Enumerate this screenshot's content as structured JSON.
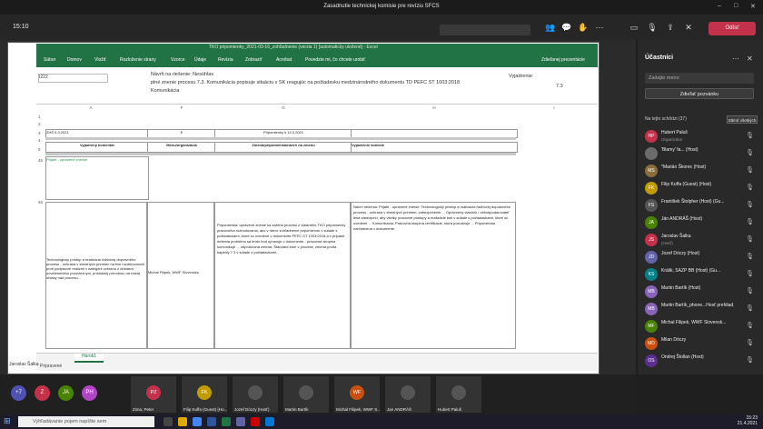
{
  "window": {
    "title": "Zasadnutie technickej komisie pre revíziu SFCS",
    "min": "–",
    "max": "□",
    "close": "✕"
  },
  "meeting": {
    "timer": "15:10",
    "toolbar_button_1": "Prestať prezentovať",
    "toolbar_button_2": "Zastaviť prezentáciu",
    "leave_label": "Odísť",
    "icons": [
      "participants-icon",
      "chat-icon",
      "raise-hand-icon",
      "more-icon",
      "camera-icon",
      "mic-icon",
      "share-icon"
    ]
  },
  "excel": {
    "title": "TKO pripomienky_2021-03-16_zohľadnenie (verzia 1) [automaticky uložené] - Excel",
    "ribbon_tabs": [
      "Súbor",
      "Domov",
      "Vložiť",
      "Rozloženie strany",
      "Vzorce",
      "Údaje",
      "Revízia",
      "Zobraziť",
      "Acrobat"
    ],
    "tell_me": "Povedzte mi, čo chcete urobiť",
    "share": "Zdieľanej prezentácie",
    "namebox": "I222",
    "formula_line1": "Návrh na riešenie: Nesúhlas",
    "formula_line2": "plné znenie procesu 7.3. Komunikácia popisuje situáciu v SK reagujúc na požiadavku medzinárodného dokumentu TD PEFC ST 1003:2018",
    "formula_line3": "Komunikácia",
    "formula_right": "Vyjadrenie:",
    "formula_right2": "7.3",
    "col_headers": [
      "A",
      "F",
      "G",
      "H",
      "I"
    ],
    "cells": {
      "date_label": "ZHŠ 5.3.2021",
      "col_g_header": "E",
      "col_h_header": "Pripomienky k 14.3.2021",
      "header_typ": "Vyjadrený komentár",
      "header_org": "Menu/organizácia",
      "header_zmena": "Zmena/pripomienka/návrh na zmenu",
      "header_vyj": "Vyjadrenie komisie",
      "row_a_text": "Prijaté - upravené zneniie",
      "left_comment": "Technologický prístup a realizácia ťažbovej dopravného procesu - ochrana v stredných premien na fixe rozdelovaních proti podpisové realizmi v kategórii ochranu z obstarov poveleneného proovieznym, príslušnéj prírodnou na nasta ohlasy nad procesu...",
      "org_cell": "Michal Filipek, WWF Slovensko",
      "middle_comment": "Pripomienka: upravené znenie sa zahŕňa procesu z vlastného TKO pripomienky pracovníka rozhodovania, ako v rámci zohľadnenie pripomienok v súlade s požiadavkami, ktoré sú uvedené v dokumente PEFC ST 1003:2018 a v prípade riešenia problému sa tento bod upravuje v dokumente - pracovná skupina komunikuje ... odporúčaná zmena: Štandard ktorí v procese, zmena podľa kapitoly 7.3 v súlade s požiadavkami...",
      "right_comment": "Návrh riešenia: Prijaté - upravené znenie: Technologický prístup a realizácia ťažbovej dopravného procesu - ochrana v stredných premien, zabezpečenie ... Oprávnený vlastník / obhospodarovateľ lesa zabezpečí, aby všetky pracovné postupy a realizácie boli v súlade s požiadavkami, ktoré sú uvedené ... Komunikácia. Pracovná skupina certifikácie, ktorá posudzuje ... Pripomienka zohľadnená v dokumente."
    },
    "row_numbers": [
      "1",
      "2",
      "3",
      "4",
      "5",
      "45",
      "46"
    ],
    "sheet_tab": "Hárok1",
    "status_left": "Pripravené",
    "presenter_label": "Jaroslav Šalka"
  },
  "panel": {
    "title": "Účastníci",
    "search_placeholder": "Zadajte meno",
    "share_btn": "Zdieľať pozvánku",
    "section_label": "Na tejto schôdzi (37)",
    "mute_all": "Stlmiť všetkých",
    "participants": [
      {
        "initials": "HP",
        "name": "Hubert Paluš",
        "sub": "Organizátor",
        "color": "#c4314b"
      },
      {
        "initials": "",
        "name": "'Blamy' fa... (Host)",
        "sub": "",
        "color": "#6b6b6b"
      },
      {
        "initials": "MS",
        "name": "*Marián Škorec (Host)",
        "sub": "",
        "color": "#8a6d3b"
      },
      {
        "initials": "FK",
        "name": "Filip Kuffa (Guest) (Host)",
        "sub": "",
        "color": "#c19c00"
      },
      {
        "initials": "FS",
        "name": "František Štolpher (Host) (Gu...",
        "sub": "",
        "color": "#555"
      },
      {
        "initials": "JA",
        "name": "Ján ANDRÁŠ (Host)",
        "sub": "",
        "color": "#498205"
      },
      {
        "initials": "JS",
        "name": "Jaroslav Šalka",
        "sub": "(Hosť)",
        "color": "#c4314b"
      },
      {
        "initials": "JD",
        "name": "Jozef Dóczy (Host)",
        "sub": "",
        "color": "#6264a7"
      },
      {
        "initials": "KS",
        "name": "Králik, SAZP BB (Host) (Gu...",
        "sub": "",
        "color": "#038387"
      },
      {
        "initials": "MB",
        "name": "Martin Bartík (Host)",
        "sub": "",
        "color": "#8764b8"
      },
      {
        "initials": "MB",
        "name": "Martin Bartík_phone...Hosť prehliad.",
        "sub": "",
        "color": "#8764b8"
      },
      {
        "initials": "MF",
        "name": "Michal Filipek, WWF Slovensk...",
        "sub": "",
        "color": "#498205"
      },
      {
        "initials": "MD",
        "name": "Milan Dóczy",
        "sub": "",
        "color": "#ca5010"
      },
      {
        "initials": "OS",
        "name": "Ondrej Štollan (Host)",
        "sub": "",
        "color": "#5c2e91"
      }
    ]
  },
  "gallery": {
    "avatars": [
      {
        "initials": "+7",
        "color": "#4f52b2"
      },
      {
        "initials": "Z",
        "color": "#c4314b"
      },
      {
        "initials": "JA",
        "color": "#498205"
      },
      {
        "initials": "PH",
        "color": "#b146c2"
      }
    ],
    "tiles": [
      {
        "initials": "PZ",
        "name": "Zima, Peter",
        "color": "#c4314b"
      },
      {
        "initials": "FK",
        "name": "Filip Kuffa (Guest) (Ho...",
        "color": "#c19c00"
      },
      {
        "initials": "",
        "name": "Jozef Dóczy (Hosť)",
        "color": "#555"
      },
      {
        "initials": "",
        "name": "Martin Bartík",
        "color": "#555"
      },
      {
        "initials": "WF",
        "name": "Michal Filipek, WWF S...",
        "color": "#ca5010"
      },
      {
        "initials": "",
        "name": "Jan ANDRÁŠ",
        "color": "#555"
      },
      {
        "initials": "",
        "name": "Hubert Paluš",
        "color": "#555"
      }
    ]
  },
  "taskbar": {
    "search_placeholder": "Vyhľadávanie pojem napíšte sem",
    "time": "15:23",
    "date": "21.4.2021"
  }
}
